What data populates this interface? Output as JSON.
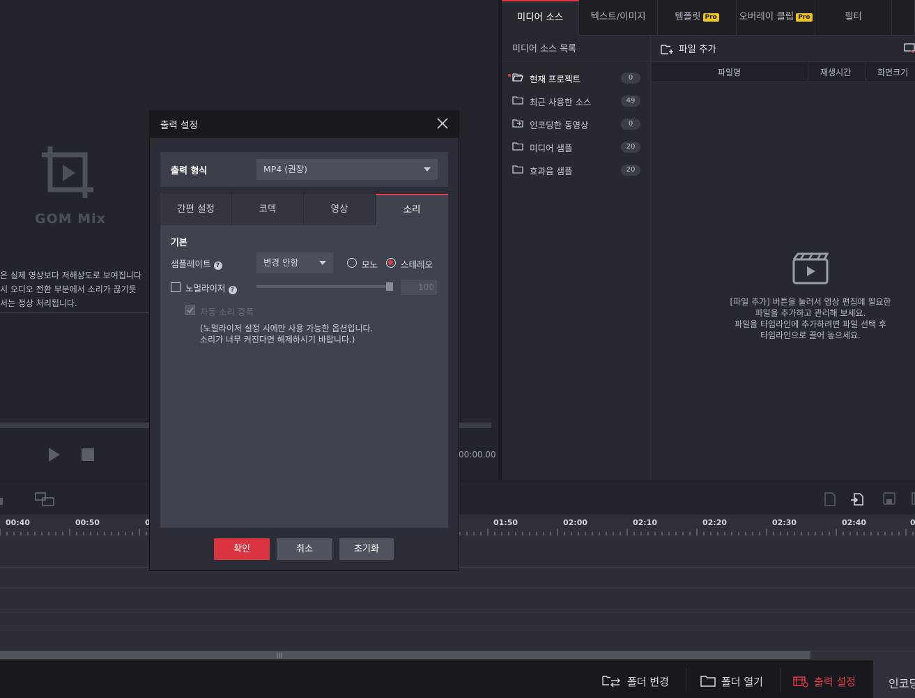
{
  "preview": {
    "logo_text": "GOM Mix",
    "notice_lines": [
      "은 실제 영상보다 저해상도로 보여집니다",
      " 시 오디오 전환 부분에서 소리가 끊기듯",
      "서는 정상 처리됩니다."
    ],
    "timecode": "00:00.00"
  },
  "right_tabs": [
    {
      "label": "미디어 소스",
      "pro": ""
    },
    {
      "label": "텍스트/이미지",
      "pro": ""
    },
    {
      "label": "템플릿",
      "pro": "Pro"
    },
    {
      "label": "오버레이 클립",
      "pro": "Pro"
    },
    {
      "label": "필터",
      "pro": ""
    },
    {
      "label": "영",
      "pro": ""
    }
  ],
  "media_source": {
    "list_title": "미디어 소스 목록",
    "items": [
      {
        "label": "현재 프로젝트",
        "count": "0"
      },
      {
        "label": "최근 사용한 소스",
        "count": "49"
      },
      {
        "label": "인코딩한 동영상",
        "count": "0"
      },
      {
        "label": "미디어 샘플",
        "count": "20"
      },
      {
        "label": "효과음 샘플",
        "count": "20"
      }
    ],
    "file_add": "파일 추가",
    "columns": [
      "파일명",
      "재생시간",
      "화면크기"
    ],
    "empty_lines": [
      "[파일 추가] 버튼을 눌러서 영상 편집에 필요한",
      "파일을 추가하고 관리해 보세요.",
      "파일을 타임라인에 추가하려면 파일 선택 후",
      "타임라인으로 끌어 놓으세요."
    ]
  },
  "timeline": {
    "ticks_left": [
      "00:40",
      "00:50",
      "0"
    ],
    "ticks_right": [
      "01:50",
      "02:00",
      "02:10",
      "02:20",
      "02:30",
      "02:40",
      "0"
    ]
  },
  "bottom_bar": {
    "folder_change": "폴더 변경",
    "folder_open": "폴더 열기",
    "output_settings": "출력 설정",
    "encode": "인코딩"
  },
  "dialog": {
    "title": "출력 설정",
    "format_label": "출력 형식",
    "format_value": "MP4 (권장)",
    "tabs": [
      "간편 설정",
      "코덱",
      "영상",
      "소리"
    ],
    "section": "기본",
    "samplerate_label": "샘플레이트",
    "samplerate_value": "변경 안함",
    "mono": "모노",
    "stereo": "스테레오",
    "normalizer_label": "노멀라이저",
    "normalizer_value": "100",
    "auto_amp": "자동 소리 증폭",
    "hint_lines": [
      "(노멀라이저 설정 시에만 사용 가능한 옵션입니다.",
      "소리가 너무 커진다면 해제하시기 바랍니다.)"
    ],
    "ok": "확인",
    "cancel": "취소",
    "reset": "초기화"
  },
  "colors": {
    "accent": "#e2394a",
    "pro_badge": "#f0c419",
    "background": "#1f2229"
  }
}
